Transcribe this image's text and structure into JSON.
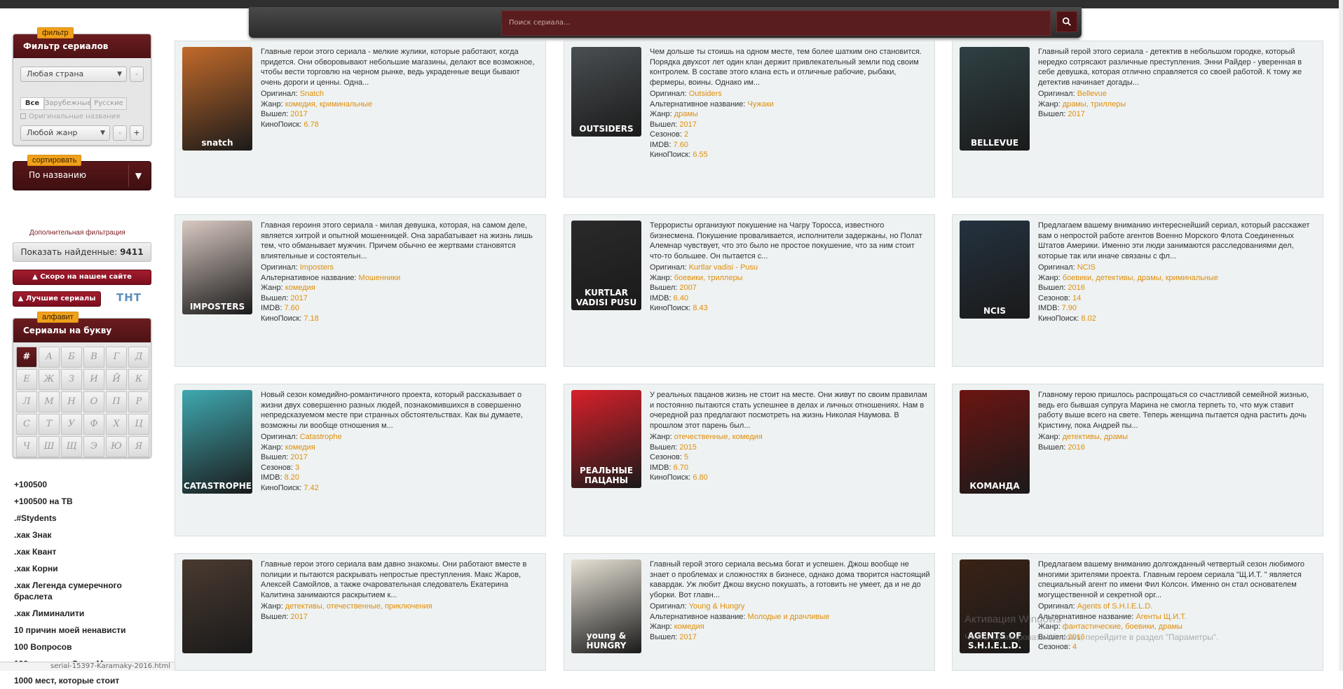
{
  "search": {
    "placeholder": "Поиск сериала..."
  },
  "filter": {
    "tag": "фильтр",
    "title": "Фильтр сериалов",
    "country": "Любая страна",
    "segments": [
      "Все",
      "Зарубежные",
      "Русские"
    ],
    "orig_names": "Оригинальные названия",
    "genre": "Любой жанр",
    "minus": "-",
    "plus": "+"
  },
  "sort": {
    "tag": "сортировать",
    "value": "По названию"
  },
  "adv_filter": "Дополнительная фильтрация",
  "found": {
    "label": "Показать найденные:",
    "count": "9411"
  },
  "soon_btn": "Скоро на нашем сайте",
  "best_btn": "Лучшие сериалы",
  "tnt": "ТНТ",
  "alpha": {
    "tag": "алфавит",
    "title": "Сериалы на букву",
    "letters": [
      "#",
      "А",
      "Б",
      "В",
      "Г",
      "Д",
      "Е",
      "Ж",
      "З",
      "И",
      "Й",
      "К",
      "Л",
      "М",
      "Н",
      "О",
      "П",
      "Р",
      "С",
      "Т",
      "У",
      "Ф",
      "Х",
      "Ц",
      "Ч",
      "Ш",
      "Щ",
      "Э",
      "Ю",
      "Я"
    ]
  },
  "series_list": [
    "+100500",
    "+100500 на ТВ",
    ".#Stydents",
    ".хак Знак",
    ".хак Квант",
    ".хак Корни",
    ".хак Легенда сумеречного браслета",
    ".хак Лиминалити",
    "10 причин моей ненависти",
    "100 Вопросов",
    "100 подвигов Эдди Макдауда",
    "1000 мест, которые стоит"
  ],
  "status_text": "serial-15397-Karamaky-2016.html",
  "labels": {
    "orig": "Оригинал:",
    "alt": "Альтернативное название:",
    "genre": "Жанр:",
    "year": "Вышел:",
    "seasons": "Сезонов:",
    "imdb": "IMDB:",
    "kp": "КиноПоиск:"
  },
  "cards": [
    {
      "desc": "Главные герои этого сериала - мелкие жулики, которые работают, когда придется. Они обворовывают небольшие магазины, делают все возможное, чтобы вести торговлю на черном рынке, ведь украденные вещи бывают очень дороги и ценны. Одна...",
      "poster_text": "snatch",
      "poster_color": "#c26a2a",
      "orig": "Snatch",
      "alt": "",
      "genre": "комедия, криминальные",
      "year": "2017",
      "seasons": "",
      "imdb": "",
      "kp": "6.78"
    },
    {
      "desc": "Чем дольше ты стоишь на одном месте, тем более шатким оно становится. Порядка двухсот лет один клан держит привлекательный земли под своим контролем. В составе этого клана есть и отличные рабочие, рыбаки, фермеры, воины. Однако им...",
      "poster_text": "OUTSIDERS",
      "poster_color": "#4a4f52",
      "orig": "Outsiders",
      "alt": "Чужаки",
      "genre": "драмы",
      "year": "2017",
      "seasons": "2",
      "imdb": "7.60",
      "kp": "6.55"
    },
    {
      "desc": "Главный герой этого сериала - детектив в небольшом городке, который нередко сотрясают различные преступления. Энни Райдер - уверенная в себе девушка, которая отлично справляется со своей работой. К тому же детектив начинает догады...",
      "poster_text": "BELLEVUE",
      "poster_color": "#2f4043",
      "orig": "Bellevue",
      "alt": "",
      "genre": "драмы, триллеры",
      "year": "2017",
      "seasons": "",
      "imdb": "",
      "kp": ""
    },
    {
      "desc": "Главная героиня этого сериала - милая девушка, которая, на самом деле, является хитрой и опытной мошенницей. Она зарабатывает на жизнь лишь тем, что обманывает мужчин. Причем обычно ее жертвами становятся влиятельные и состоятельн...",
      "poster_text": "IMPOSTERS",
      "poster_color": "#d9c9c2",
      "orig": "Imposters",
      "alt": "Мошенники",
      "genre": "комедия",
      "year": "2017",
      "seasons": "",
      "imdb": "7.60",
      "kp": "7.18"
    },
    {
      "desc": "Террористы организуют покушение на Чагру Торосса, известного бизнесмена. Покушение проваливается, исполнители задержаны, но Полат Алемнар чувствует, что это было не простое покушение, что за ним стоит что-то большее. Он пытается с...",
      "poster_text": "KURTLAR VADISI PUSU",
      "poster_color": "#2a2a2a",
      "orig": "Kurtlar vadisi - Pusu",
      "alt": "",
      "genre": "боевики, триллеры",
      "year": "2007",
      "seasons": "",
      "imdb": "6.40",
      "kp": "8.43"
    },
    {
      "desc": "Предлагаем вашему вниманию интереснейший сериал, который расскажет вам о непростой работе агентов Военно Морского Флота Соединенных Штатов Америки. Именно эти люди занимаются расследованиями дел, которые так или иначе связаны с фл...",
      "poster_text": "NCIS",
      "poster_color": "#24323f",
      "orig": "NCIS",
      "alt": "",
      "genre": "боевики, детективы, драмы, криминальные",
      "year": "2016",
      "seasons": "14",
      "imdb": "7.90",
      "kp": "8.02"
    },
    {
      "desc": "Новый сезон комедийно-романтичного проекта, который рассказывает о жизни двух совершенно разных людей, познакомившихся в совершенно непредсказуемом месте при странных обстоятельствах. Как вы думаете, возможны ли вообще отношения м...",
      "poster_text": "CATASTROPHE",
      "poster_color": "#3fa8b0",
      "orig": "Catastrophe",
      "alt": "",
      "genre": "комедия",
      "year": "2017",
      "seasons": "3",
      "imdb": "8.20",
      "kp": "7.42"
    },
    {
      "desc": "У реальных пацанов жизнь не стоит на месте. Они живут по своим правилам и постоянно пытаются стать успешнее в делах и личных отношениях. Нам в очередной раз предлагают посмотреть на жизнь Николая Наумова. В прошлом этот парень был...",
      "poster_text": "РЕАЛЬНЫЕ ПАЦАНЫ",
      "poster_color": "#d8202a",
      "orig": "",
      "alt": "",
      "genre": "отечественные, комедия",
      "year": "2015",
      "seasons": "5",
      "imdb": "6.70",
      "kp": "6.80"
    },
    {
      "desc": "Главному герою пришлось распрощаться со счастливой семейной жизнью, ведь его бывшая супруга Марина не смогла терпеть то, что муж ставит работу выше всего на свете. Теперь женщина пытается одна растить дочь Кристину, пока Андрей пы...",
      "poster_text": "КОМАНДА",
      "poster_color": "#6b1512",
      "orig": "",
      "alt": "",
      "genre": "детективы, драмы",
      "year": "2016",
      "seasons": "",
      "imdb": "",
      "kp": ""
    },
    {
      "desc": "Главные герои этого сериала вам давно знакомы. Они работают вместе в полиции и пытаются раскрывать непростые преступления. Макс Жаров, Алексей Самойлов, а также очаровательная следователь Екатерина Калитина занимаются раскрытием к...",
      "poster_text": "",
      "poster_color": "#4a3a30",
      "orig": "",
      "alt": "",
      "genre": "детективы, отечественные, приключения",
      "year": "2017",
      "seasons": "",
      "imdb": "",
      "kp": ""
    },
    {
      "desc": "Главный герой этого сериала весьма богат и успешен. Джош вообще не знает о проблемах и сложностях в бизнесе, однако дома творится настоящий кавардак. Уж любит Джош вкусно покушать, а готовить не умеет, да и не до уборки. Вот главн...",
      "poster_text": "young & HUNGRY",
      "poster_color": "#e7e2d6",
      "orig": "Young & Hungry",
      "alt": "Молодые и драчливые",
      "genre": "комедия",
      "year": "2017",
      "seasons": "",
      "imdb": "",
      "kp": ""
    },
    {
      "desc": "Предлагаем вашему вниманию долгожданный четвертый сезон любимого многими зрителями проекта. Главным героем сериала \"Щ.И.Т. \" является специальный агент по имени Фил Колсон. Именно он стал основателем могущественной и секретной орг...",
      "poster_text": "AGENTS OF S.H.I.E.L.D.",
      "poster_color": "#3a2216",
      "orig": "Agents of S.H.I.E.L.D.",
      "alt": "Агенты Щ.И.Т.",
      "genre": "фантастические, боевики, драмы",
      "year": "2016",
      "seasons": "4",
      "imdb": "",
      "kp": ""
    }
  ],
  "watermark": {
    "line1": "Активация Windows",
    "line2": "Чтобы активировать Windows, перейдите в раздел \"Параметры\"."
  }
}
